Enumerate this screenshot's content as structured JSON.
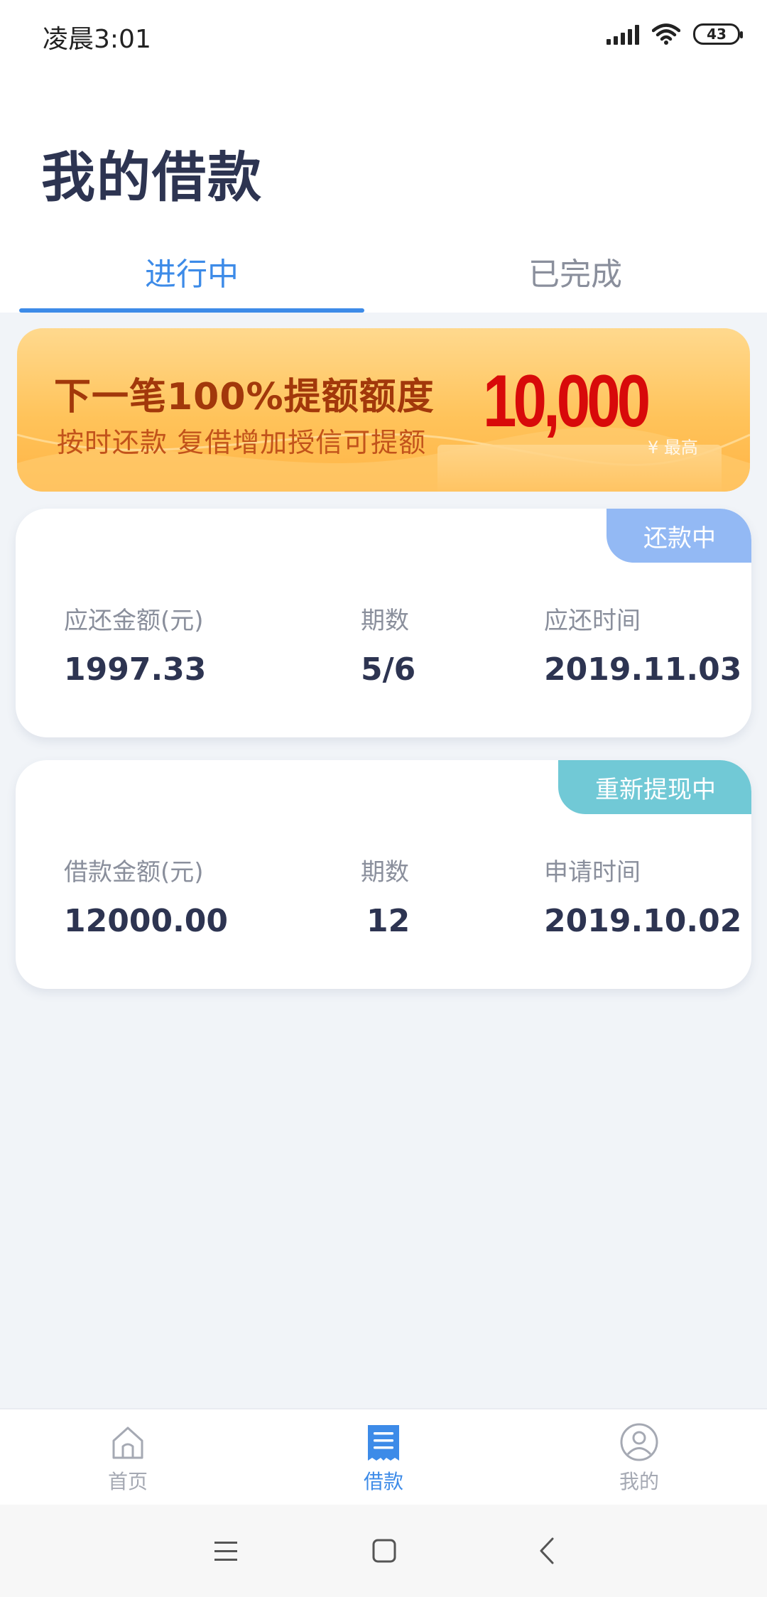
{
  "status_bar": {
    "time": "凌晨3:01",
    "battery": "43"
  },
  "page": {
    "title": "我的借款"
  },
  "tabs": [
    {
      "label": "进行中",
      "active": true
    },
    {
      "label": "已完成",
      "active": false
    }
  ],
  "banner": {
    "headline": "下一笔100%提额额度",
    "subline": "按时还款  复借增加授信可提额",
    "amount": "10,000",
    "amount_note": "¥ 最高"
  },
  "loans": [
    {
      "status": "还款中",
      "status_color": "#93b9f4",
      "fields": [
        {
          "label": "应还金额(元)",
          "value": "1997.33"
        },
        {
          "label": "期数",
          "value": "5/6"
        },
        {
          "label": "应还时间",
          "value": "2019.11.03"
        }
      ]
    },
    {
      "status": "重新提现中",
      "status_color": "#71c9d6",
      "fields": [
        {
          "label": "借款金额(元)",
          "value": "12000.00"
        },
        {
          "label": "期数",
          "value": "12"
        },
        {
          "label": "申请时间",
          "value": "2019.10.02"
        }
      ]
    }
  ],
  "bottom_nav": [
    {
      "label": "首页",
      "icon": "home-icon",
      "active": false
    },
    {
      "label": "借款",
      "icon": "loan-document-icon",
      "active": true
    },
    {
      "label": "我的",
      "icon": "profile-icon",
      "active": false
    }
  ],
  "colors": {
    "accent": "#3d8be8",
    "title": "#2d3451",
    "background": "#f1f4f8"
  }
}
